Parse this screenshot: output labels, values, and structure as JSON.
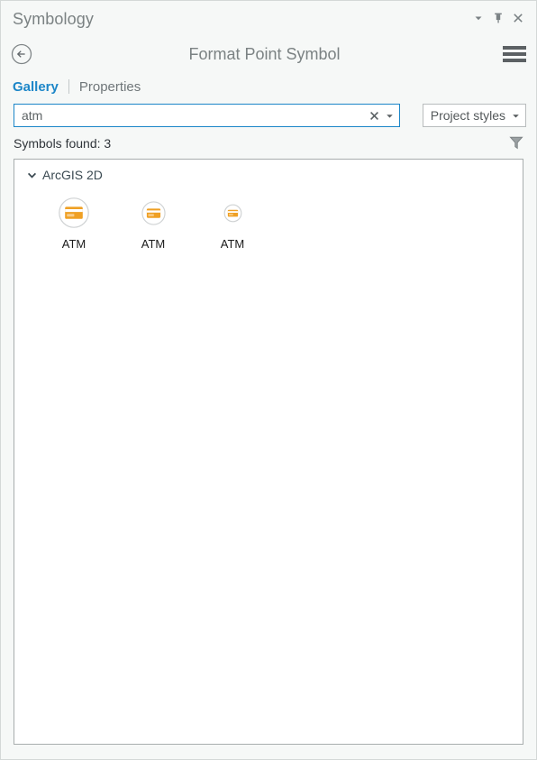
{
  "window": {
    "title": "Symbology",
    "controls": [
      {
        "name": "menu-caret-icon",
        "glyph": "caret-down"
      },
      {
        "name": "pin-icon",
        "glyph": "pin"
      },
      {
        "name": "close-icon",
        "glyph": "close"
      }
    ]
  },
  "command_row": {
    "back_label": "back",
    "back_icon": "circle-arrow-left-icon",
    "heading": "Format Point Symbol",
    "menu_icon": "hamburger-menu-icon"
  },
  "tabs": [
    {
      "label": "Gallery",
      "active": true
    },
    {
      "label": "Properties",
      "active": false
    }
  ],
  "search": {
    "value": "atm",
    "placeholder": "Search",
    "clear_icon": "close-icon",
    "history_icon": "caret-down-icon",
    "styles_scope": "Project styles",
    "styles_caret_icon": "caret-down-icon"
  },
  "results": {
    "found_text": "Symbols found: 3",
    "filter_icon": "funnel-filter-icon"
  },
  "gallery": {
    "groups": [
      {
        "name": "ArcGIS 2D",
        "expanded": true,
        "chevron_icon": "chevron-down-icon",
        "items": [
          {
            "label": "ATM",
            "symbol": "atm-card-symbol",
            "size": 34
          },
          {
            "label": "ATM",
            "symbol": "atm-card-symbol",
            "size": 26
          },
          {
            "label": "ATM",
            "symbol": "atm-card-symbol",
            "size": 19
          }
        ]
      }
    ]
  },
  "colors": {
    "accent": "#1c86c8",
    "symbol_orange": "#efa024",
    "symbol_orange_dark": "#e8951a",
    "panel_bg": "#f6f8f7",
    "title_gray": "#7b8283",
    "text_dark": "#30353a"
  }
}
